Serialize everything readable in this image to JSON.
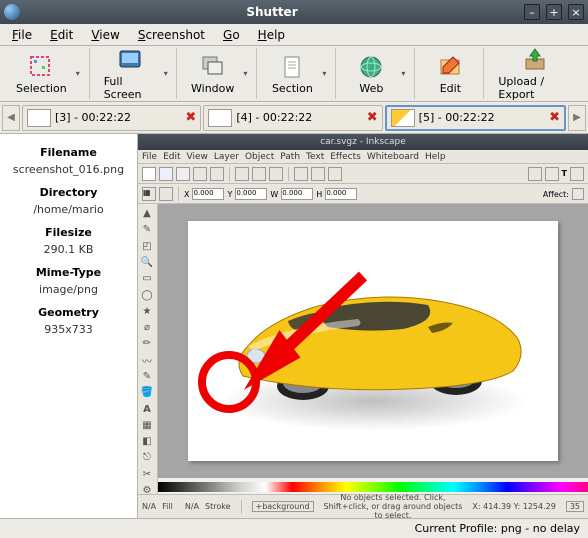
{
  "window": {
    "title": "Shutter"
  },
  "menu": {
    "file": "File",
    "edit": "Edit",
    "view": "View",
    "screenshot": "Screenshot",
    "go": "Go",
    "help": "Help"
  },
  "toolbar": {
    "selection": "Selection",
    "fullscreen": "Full Screen",
    "window": "Window",
    "section": "Section",
    "web": "Web",
    "edit": "Edit",
    "upload": "Upload / Export"
  },
  "tabs": [
    {
      "label": "[3] - 00:22:22"
    },
    {
      "label": "[4] - 00:22:22"
    },
    {
      "label": "[5] - 00:22:22"
    }
  ],
  "props": {
    "filename_k": "Filename",
    "filename_v": "screenshot_016.png",
    "directory_k": "Directory",
    "directory_v": "/home/mario",
    "filesize_k": "Filesize",
    "filesize_v": "290.1 KB",
    "mime_k": "Mime-Type",
    "mime_v": "image/png",
    "geom_k": "Geometry",
    "geom_v": "935x733"
  },
  "ink": {
    "title": "car.svgz - Inkscape",
    "menu": [
      "File",
      "Edit",
      "View",
      "Layer",
      "Object",
      "Path",
      "Text",
      "Effects",
      "Whiteboard",
      "Help"
    ],
    "status_mid": "No objects selected. Click, Shift+click, or drag around objects to select.",
    "coords": "X: 414.39  Y: 1254.29",
    "fill": "N/A",
    "stroke": "N/A",
    "layer": "+background",
    "zoom": "35"
  },
  "status": "Current Profile: png - no delay"
}
